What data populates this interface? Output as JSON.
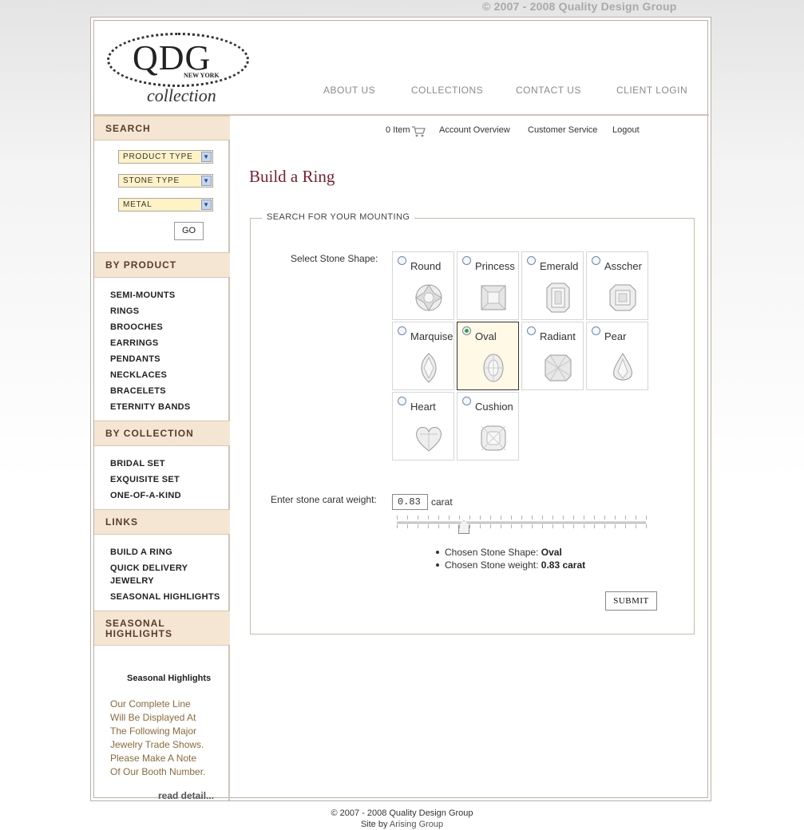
{
  "top_copyright": "© 2007 - 2008 Quality Design Group",
  "logo": {
    "mark": "QDG",
    "city": "NEW YORK",
    "word": "collection"
  },
  "topnav": [
    "ABOUT US",
    "COLLECTIONS",
    "CONTACT US",
    "CLIENT LOGIN"
  ],
  "sidebar": {
    "search_title": "SEARCH",
    "selects": [
      "PRODUCT TYPE",
      "STONE TYPE",
      "METAL"
    ],
    "go": "GO",
    "by_product_title": "BY PRODUCT",
    "by_product": [
      "SEMI-MOUNTS",
      "RINGS",
      "BROOCHES",
      "EARRINGS",
      "PENDANTS",
      "NECKLACES",
      "BRACELETS",
      "ETERNITY BANDS"
    ],
    "by_collection_title": "BY COLLECTION",
    "by_collection": [
      "BRIDAL SET",
      "EXQUISITE SET",
      "ONE-OF-A-KIND"
    ],
    "links_title": "LINKS",
    "links": [
      "BUILD A RING",
      "QUICK DELIVERY",
      "JEWELRY",
      "SEASONAL HIGHLIGHTS"
    ],
    "seasonal_title": "SEASONAL HIGHLIGHTS",
    "seasonal_subtitle": "Seasonal Highlights",
    "seasonal_text": [
      "Our Complete Line",
      "Will Be Displayed At",
      "The Following Major",
      "Jewelry Trade Shows.",
      "Please Make A Note",
      "Of Our Booth Number."
    ],
    "read_detail": "read detail..."
  },
  "utility": {
    "cart": "0 Item",
    "account": "Account Overview",
    "service": "Customer Service",
    "logout": "Logout"
  },
  "main": {
    "title": "Build a Ring",
    "legend": "SEARCH FOR YOUR MOUNTING",
    "shape_label": "Select Stone Shape:",
    "shapes": [
      {
        "name": "Round",
        "selected": false
      },
      {
        "name": "Princess",
        "selected": false
      },
      {
        "name": "Emerald",
        "selected": false
      },
      {
        "name": "Asscher",
        "selected": false
      },
      {
        "name": "Marquise",
        "selected": false
      },
      {
        "name": "Oval",
        "selected": true
      },
      {
        "name": "Radiant",
        "selected": false
      },
      {
        "name": "Pear",
        "selected": false
      },
      {
        "name": "Heart",
        "selected": false
      },
      {
        "name": "Cushion",
        "selected": false
      }
    ],
    "carat_label": "Enter stone carat weight:",
    "carat_value": "0.83",
    "carat_unit": "carat",
    "slider_level": 0.27,
    "chosen_shape_label": "Chosen Stone Shape:",
    "chosen_shape": "Oval",
    "chosen_weight_label": "Chosen Stone weight:",
    "chosen_weight": "0.83 carat",
    "submit": "SUBMIT"
  },
  "footer": {
    "line1": "© 2007 - 2008 Quality Design Group",
    "site_by": "Site by",
    "arising": "Arising Group"
  }
}
